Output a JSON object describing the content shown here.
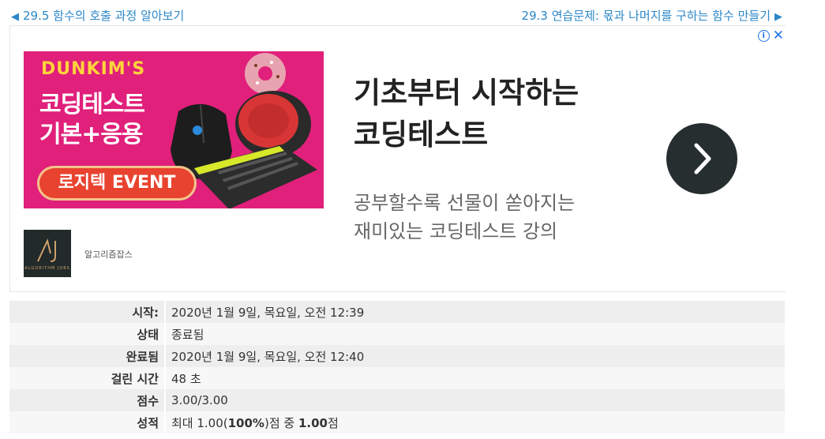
{
  "nav": {
    "prev_label": "29.5 함수의 호출 과정 알아보기",
    "next_label": "29.3 연습문제: 몫과 나머지를 구하는 함수 만들기"
  },
  "ad": {
    "info_icon": "i",
    "close_icon": "✕",
    "banner": {
      "brand": "DUNKIM'S",
      "headline_1": "코딩테스트",
      "headline_2": "기본+응용",
      "event": "로지텍 EVENT"
    },
    "logo_text": "ALGORITHM JOBS",
    "advertiser": "알고리즘잡스",
    "title_line_1": "기초부터 시작하는",
    "title_line_2": "코딩테스트",
    "desc_line_1": "공부할수록 선물이 쏟아지는",
    "desc_line_2": "재미있는 코딩테스트 강의",
    "colors": {
      "banner": "#e0207a",
      "accent": "#ffd43b",
      "button": "#262e2f"
    }
  },
  "summary": {
    "rows": [
      {
        "label": "시작:",
        "value": "2020년 1월 9일, 목요일, 오전 12:39"
      },
      {
        "label": "상태",
        "value": "종료됨"
      },
      {
        "label": "완료됨",
        "value": "2020년 1월 9일, 목요일, 오전 12:40"
      },
      {
        "label": "걸린 시간",
        "value": "48 초"
      },
      {
        "label": "점수",
        "value": "3.00/3.00"
      },
      {
        "label": "성적",
        "value_prefix": "최대 1.00(",
        "value_pct": "100%",
        "value_mid": ")점 중 ",
        "value_score": "1.00",
        "value_suffix": "점"
      }
    ]
  }
}
